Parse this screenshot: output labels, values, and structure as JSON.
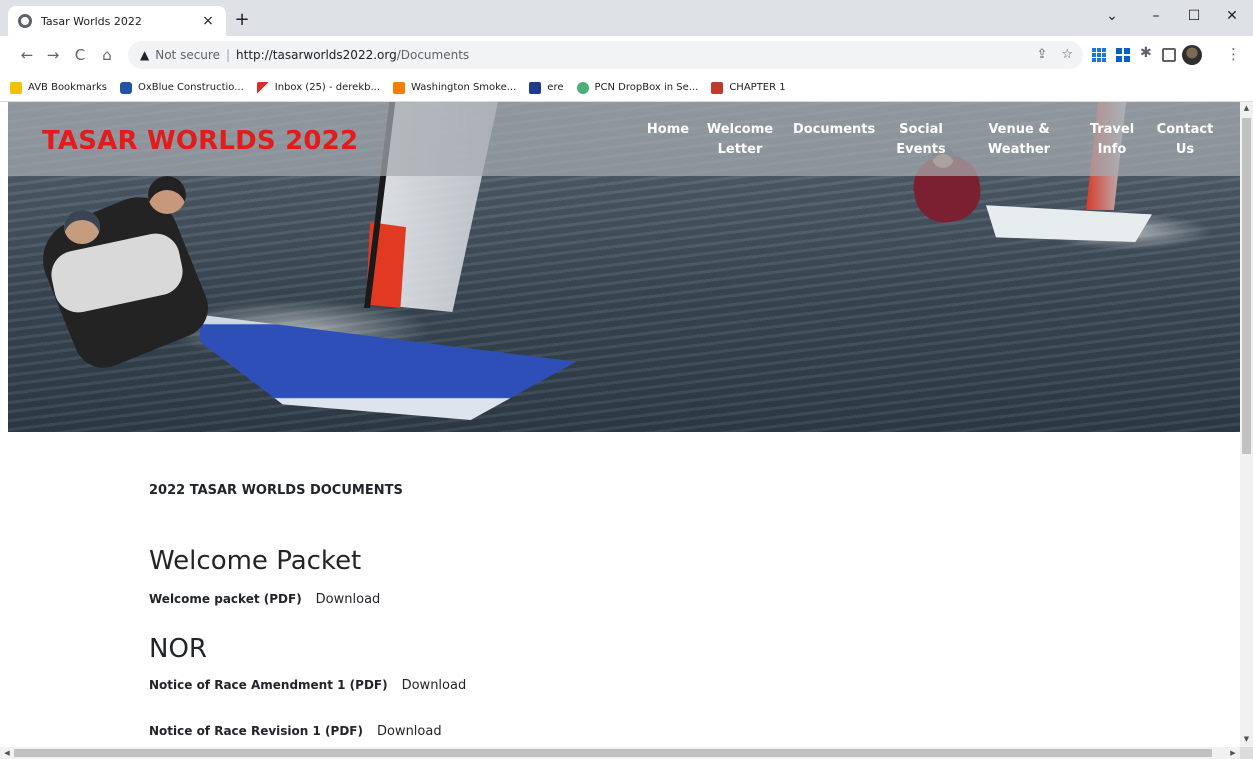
{
  "browser": {
    "tab": {
      "title": "Tasar Worlds 2022",
      "close": "×"
    },
    "new_tab": "+",
    "window": {
      "minimize": "–",
      "maximize": "☐",
      "close": "✕",
      "tab_search": "⌄"
    },
    "nav": {
      "back": "←",
      "forward": "→",
      "reload": "C",
      "home": "⌂"
    },
    "omnibox": {
      "security_text": "Not secure",
      "separator": "|",
      "url_host": "http://tasarworlds2022.org",
      "url_path": "/Documents",
      "share_icon": "⇪",
      "star_icon": "☆"
    },
    "extensions": {
      "puzzle_icon": "✱",
      "menu_icon": "⋮"
    },
    "bookmarks": [
      {
        "label": "AVB Bookmarks",
        "icon": "folder-icon",
        "color": "#f2c200"
      },
      {
        "label": "OxBlue Constructio...",
        "icon": "oxblue-icon",
        "color": "#2453a6"
      },
      {
        "label": "Inbox (25) - derekb...",
        "icon": "gmail-icon",
        "color": "#d93025"
      },
      {
        "label": "Washington Smoke...",
        "icon": "blogger-icon",
        "color": "#f57d00"
      },
      {
        "label": "ere",
        "icon": "ere-icon",
        "color": "#1f3b8c"
      },
      {
        "label": "PCN DropBox in Se...",
        "icon": "pcn-icon",
        "color": "#4caf7a"
      },
      {
        "label": "CHAPTER 1",
        "icon": "chapter-icon",
        "color": "#c0392b"
      }
    ]
  },
  "site": {
    "title": "TASAR WORLDS 2022",
    "title_color": "#e31b1b",
    "nav": [
      {
        "label": "Home"
      },
      {
        "label": "Welcome Letter"
      },
      {
        "label": "Documents"
      },
      {
        "label": "Social Events"
      },
      {
        "label": "Venue & Weather"
      },
      {
        "label": "Travel Info"
      },
      {
        "label": "Contact Us"
      }
    ]
  },
  "documents": {
    "heading": "2022 TASAR WORLDS DOCUMENTS",
    "sections": [
      {
        "title": "Welcome Packet",
        "items": [
          {
            "label": "Welcome packet (PDF)",
            "link": "Download"
          }
        ]
      },
      {
        "title": "NOR",
        "items": [
          {
            "label": "Notice of Race Amendment 1 (PDF)",
            "link": "Download"
          },
          {
            "label": "Notice of Race Revision 1 (PDF)",
            "link": "Download"
          }
        ]
      }
    ]
  }
}
